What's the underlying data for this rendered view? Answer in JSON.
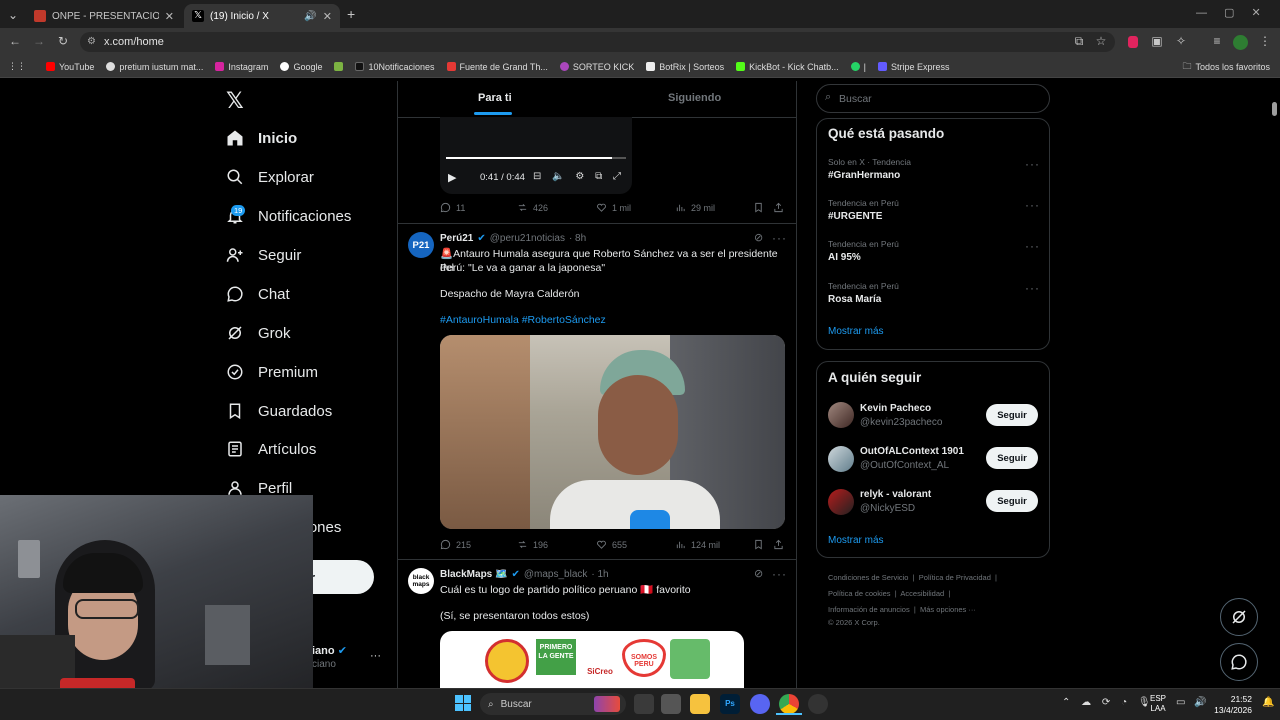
{
  "browser": {
    "tabs": [
      {
        "title": "ONPE - PRESENTACIÓN DE RES",
        "close": "✕"
      },
      {
        "title": "(19) Inicio / X",
        "close": "✕"
      }
    ],
    "new_tab": "+",
    "url": "x.com/home",
    "bookmarks": [
      "YouTube",
      "pretium iustum mat...",
      "Instagram",
      "Google",
      "",
      "10Notificaciones",
      "Fuente de Grand Th...",
      "SORTEO KICK",
      "BotRix | Sorteos",
      "KickBot - Kick Chatb...",
      "",
      "Stripe Express"
    ],
    "all_bookmarks": "Todos los favoritos"
  },
  "sidebar": {
    "items": [
      {
        "label": "Inicio",
        "icon": "home-icon",
        "active": true
      },
      {
        "label": "Explorar",
        "icon": "search-icon"
      },
      {
        "label": "Notificaciones",
        "icon": "bell-icon",
        "badge": "19"
      },
      {
        "label": "Seguir",
        "icon": "person-add-icon"
      },
      {
        "label": "Chat",
        "icon": "chat-icon"
      },
      {
        "label": "Grok",
        "icon": "grok-icon"
      },
      {
        "label": "Premium",
        "icon": "premium-icon"
      },
      {
        "label": "Guardados",
        "icon": "bookmark-icon"
      },
      {
        "label": "Artículos",
        "icon": "articles-icon"
      },
      {
        "label": "Perfil",
        "icon": "person-icon"
      },
      {
        "label": "ciones"
      }
    ],
    "post_button": "r",
    "account_name": "iano",
    "account_handle": "ciano",
    "account_more": "···"
  },
  "feed": {
    "tabs": [
      "Para ti",
      "Siguiendo"
    ],
    "video": {
      "time": "0:41 / 0:44",
      "progress": 0.92
    },
    "tweet0": {
      "replies": "11",
      "retweets": "426",
      "likes": "1 mil",
      "views": "29 mil"
    },
    "tweet1": {
      "avatar": "P21",
      "name": "Perú21",
      "handle": "@peru21noticias",
      "time": "· 8h",
      "text_line1": "🚨Antauro Humala asegura que Roberto Sánchez va a ser el presidente del",
      "text_line2": "Perú: \"Le va a ganar a la japonesa\"",
      "text_line3": "Despacho de Mayra Calderón",
      "hashtags": "#AntauroHumala #RobertoSánchez",
      "replies": "215",
      "retweets": "196",
      "likes": "655",
      "views": "124 mil"
    },
    "tweet2": {
      "avatar": "black maps",
      "name": "BlackMaps 🗺️",
      "handle": "@maps_black",
      "time": "· 1h",
      "text_line1": "Cuál es tu logo de partido político peruano 🇵🇪 favorito",
      "text_line2": "(Sí, se presentaron todos estos)",
      "logos": [
        "PRIMERO LA GENTE",
        "SiCreo",
        "SOMOS PERU"
      ]
    }
  },
  "right": {
    "search_placeholder": "Buscar",
    "trends_title": "Qué está pasando",
    "trends": [
      {
        "meta": "Solo en X · Tendencia",
        "name": "#GranHermano"
      },
      {
        "meta": "Tendencia en Perú",
        "name": "#URGENTE"
      },
      {
        "meta": "Tendencia en Perú",
        "name": "AI 95%"
      },
      {
        "meta": "Tendencia en Perú",
        "name": "Rosa María"
      }
    ],
    "trends_more": "Mostrar más",
    "who_title": "A quién seguir",
    "who": [
      {
        "name": "Kevin Pacheco",
        "handle": "@kevin23pacheco",
        "button": "Seguir"
      },
      {
        "name": "OutOfALContext 1901",
        "handle": "@OutOfContext_AL",
        "button": "Seguir"
      },
      {
        "name": "relyk - valorant",
        "handle": "@NickyESD",
        "button": "Seguir"
      }
    ],
    "who_more": "Mostrar más",
    "footer_l1": [
      "Condiciones de Servicio",
      "Política de Privacidad"
    ],
    "footer_l2": [
      "Política de cookies",
      "Accesibilidad"
    ],
    "footer_l3": [
      "Información de anuncios",
      "Más opciones ···"
    ],
    "copyright": "© 2026 X Corp."
  },
  "taskbar": {
    "search": "Buscar",
    "lang1": "ESP",
    "lang2": "LAA",
    "time": "21:52",
    "date": "13/4/2026"
  },
  "colors": {
    "accent": "#1d9bf0",
    "bg": "#000000",
    "border": "#2f3336",
    "muted": "#71767b"
  }
}
